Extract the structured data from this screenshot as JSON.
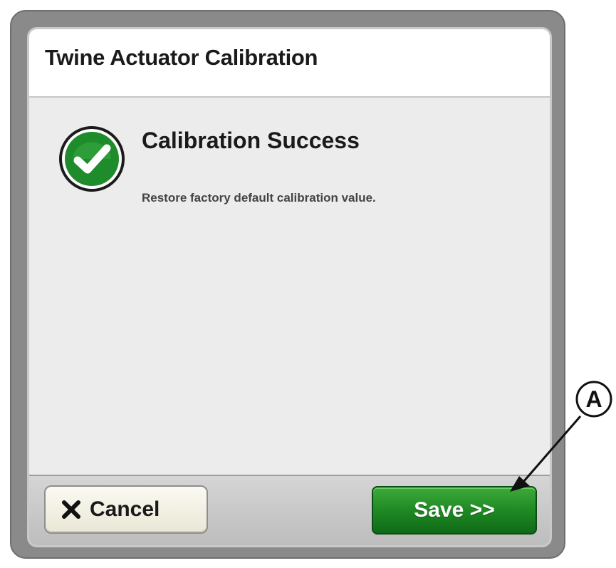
{
  "dialog": {
    "title": "Twine Actuator Calibration",
    "message_heading": "Calibration Success",
    "message_detail": "Restore factory default calibration value.",
    "status_icon": "check-circle-icon",
    "status_color": "#1e8c2a"
  },
  "footer": {
    "cancel_label": "Cancel",
    "cancel_icon": "close-icon",
    "save_label": "Save >>",
    "save_color": "#1f8a23"
  },
  "callout": {
    "label": "A"
  }
}
